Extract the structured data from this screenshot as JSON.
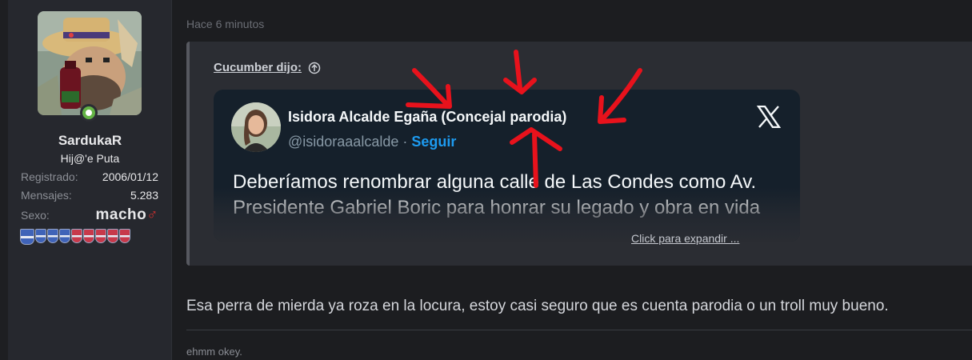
{
  "user": {
    "username": "SardukaR",
    "title": "Hij@'e Puta",
    "stats": [
      {
        "label": "Registrado:",
        "value": "2006/01/12"
      },
      {
        "label": "Mensajes:",
        "value": "5.283"
      }
    ],
    "sex_label": "Sexo:",
    "sex_value": "macho",
    "sex_symbol": "♂",
    "badge_colors": [
      "#3f63b8",
      "#3f63b8",
      "#3f63b8",
      "#3f63b8",
      "#c7394a",
      "#c7394a",
      "#c7394a",
      "#c7394a",
      "#c7394a"
    ]
  },
  "post": {
    "time": "Hace 6 minutos",
    "quote_author": "Cucumber dijo:",
    "tweet": {
      "name": "Isidora Alcalde Egaña (Concejal parodia)",
      "handle": "@isidoraaalcalde",
      "separator": " · ",
      "follow": "Seguir",
      "text": "Deberíamos renombrar alguna calle de Las Condes como Av. Presidente Gabriel Boric para honrar su legado y obra en vida"
    },
    "expand_label": "Click para expandir ...",
    "reply": "Esa perra de mierda ya roza en la locura, estoy casi seguro que es cuenta parodia o un troll muy bueno.",
    "signature": "ehmm okey."
  },
  "colors": {
    "annotation": "#e8121c",
    "online": "#63b345",
    "link": "#1d9bf0"
  }
}
